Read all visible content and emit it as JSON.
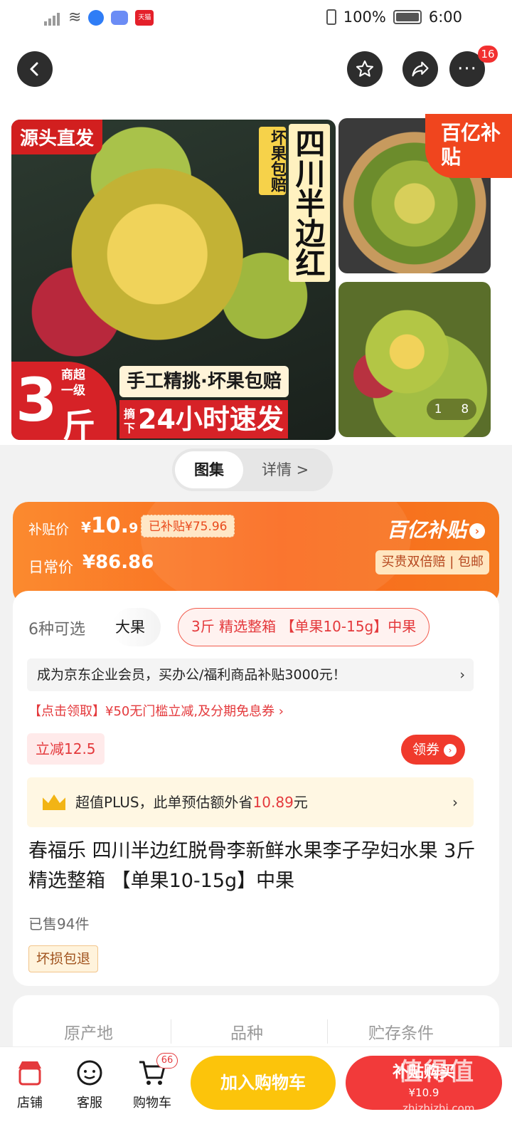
{
  "status_bar": {
    "battery": "100%",
    "time": "6:00",
    "tmall_icon": "天猫"
  },
  "top_nav": {
    "more_badge": "16"
  },
  "gallery": {
    "tag_source": "源头直发",
    "vertical_small": "坏果包赔",
    "vertical_big": "四川半边红",
    "big_number": "3",
    "big_unit": "斤",
    "big_sub": "商超一级",
    "promo_line1": "手工精挑·坏果包赔",
    "promo_line2_prefix": "摘下",
    "promo_line2": "24小时速发",
    "subsidy_tag": "百亿补贴",
    "image_index": "1",
    "image_total": "8"
  },
  "toggle": {
    "gallery": "图集",
    "detail": "详情 >"
  },
  "price_card": {
    "subsidy_label": "补贴价",
    "price_yen": "¥",
    "price_int": "10.",
    "price_dec": "9",
    "saved": "已补贴¥75.96",
    "daily_label": "日常价",
    "daily_price": "¥86.86",
    "brand": "百亿补贴",
    "assurance": "买贵双倍赔 | 包邮"
  },
  "detail": {
    "spec_count": "6种可选",
    "spec_option_1": "大果",
    "spec_selected": "3斤 精选整箱 【单果10-15g】中果",
    "member_text": "成为京东企业会员，买办公/福利商品补贴3000元！",
    "coupon_link": "【点击领取】¥50无门槛立减,及分期免息券 ›",
    "reduce_tag": "立减12.5",
    "coupon_btn": "领券",
    "plus_prefix": "超值PLUS，此单预估额外省",
    "plus_amount": "10.89",
    "plus_suffix": "元",
    "title": "春福乐 四川半边红脱骨李新鲜水果李子孕妇水果 3斤 精选整箱 【单果10-15g】中果",
    "sold": "已售94件",
    "damage_tag": "坏损包退"
  },
  "attributes": {
    "a1": "原产地",
    "a2": "品种",
    "a3": "贮存条件"
  },
  "bottom_bar": {
    "shop": "店铺",
    "service": "客服",
    "cart": "购物车",
    "cart_badge": "66",
    "add_to_cart": "加入购物车",
    "buy": "补贴购买",
    "buy_sub": "¥10.9",
    "watermark": "值得值",
    "watermark_url": "zhizhizhi.com"
  },
  "colors": {
    "accent": "#f23a3a",
    "orange": "#fa6a1e",
    "yellow": "#fcc40b"
  }
}
